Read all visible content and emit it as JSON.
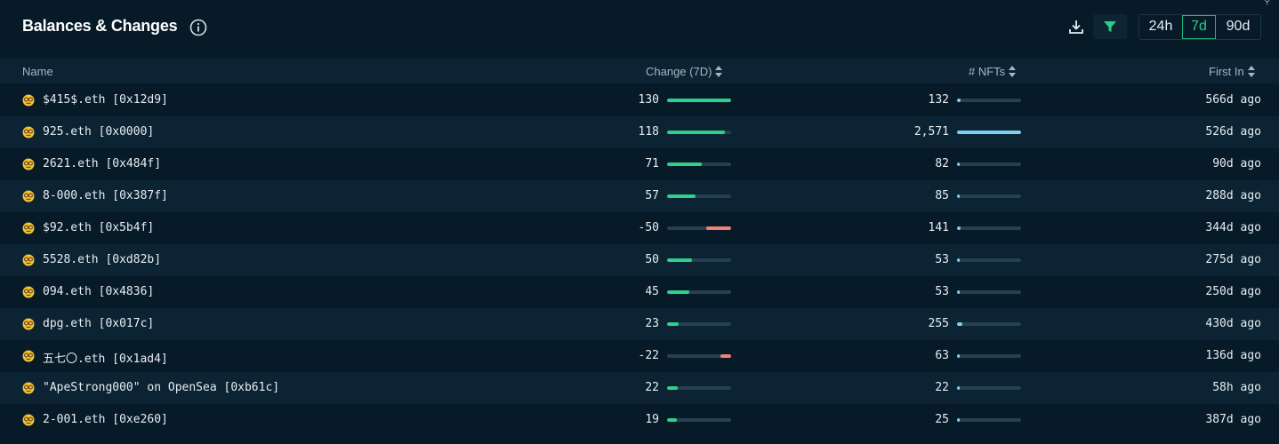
{
  "header": {
    "title": "Balances & Changes",
    "ranges": [
      "24h",
      "7d",
      "90d"
    ],
    "selected_range": "7d"
  },
  "columns": {
    "name": "Name",
    "change": "Change (7D)",
    "nfts": "# NFTs",
    "first_in": "First In"
  },
  "colors": {
    "positive": "#2fd08b",
    "negative": "#f08077",
    "nft_bar": "#7fd0ef",
    "accent": "#27d08a"
  },
  "rows": [
    {
      "name": "$415$.eth [0x12d9]",
      "change": "130",
      "change_value": 130,
      "nfts": "132",
      "nfts_value": 132,
      "first_in": "566d ago"
    },
    {
      "name": "925.eth [0x0000]",
      "change": "118",
      "change_value": 118,
      "nfts": "2,571",
      "nfts_value": 2571,
      "first_in": "526d ago"
    },
    {
      "name": "2621.eth [0x484f]",
      "change": "71",
      "change_value": 71,
      "nfts": "82",
      "nfts_value": 82,
      "first_in": "90d ago"
    },
    {
      "name": "8-000.eth [0x387f]",
      "change": "57",
      "change_value": 57,
      "nfts": "85",
      "nfts_value": 85,
      "first_in": "288d ago"
    },
    {
      "name": "$92.eth [0x5b4f]",
      "change": "-50",
      "change_value": -50,
      "nfts": "141",
      "nfts_value": 141,
      "first_in": "344d ago"
    },
    {
      "name": "5528.eth [0xd82b]",
      "change": "50",
      "change_value": 50,
      "nfts": "53",
      "nfts_value": 53,
      "first_in": "275d ago"
    },
    {
      "name": "094.eth [0x4836]",
      "change": "45",
      "change_value": 45,
      "nfts": "53",
      "nfts_value": 53,
      "first_in": "250d ago"
    },
    {
      "name": "dpg.eth [0x017c]",
      "change": "23",
      "change_value": 23,
      "nfts": "255",
      "nfts_value": 255,
      "first_in": "430d ago"
    },
    {
      "name": "五七〇.eth [0x1ad4]",
      "change": "-22",
      "change_value": -22,
      "nfts": "63",
      "nfts_value": 63,
      "first_in": "136d ago"
    },
    {
      "name": "\"ApeStrong000\" on OpenSea [0xb61c]",
      "change": "22",
      "change_value": 22,
      "nfts": "22",
      "nfts_value": 22,
      "first_in": "58h ago"
    },
    {
      "name": "2-001.eth [0xe260]",
      "change": "19",
      "change_value": 19,
      "nfts": "25",
      "nfts_value": 25,
      "first_in": "387d ago"
    }
  ]
}
